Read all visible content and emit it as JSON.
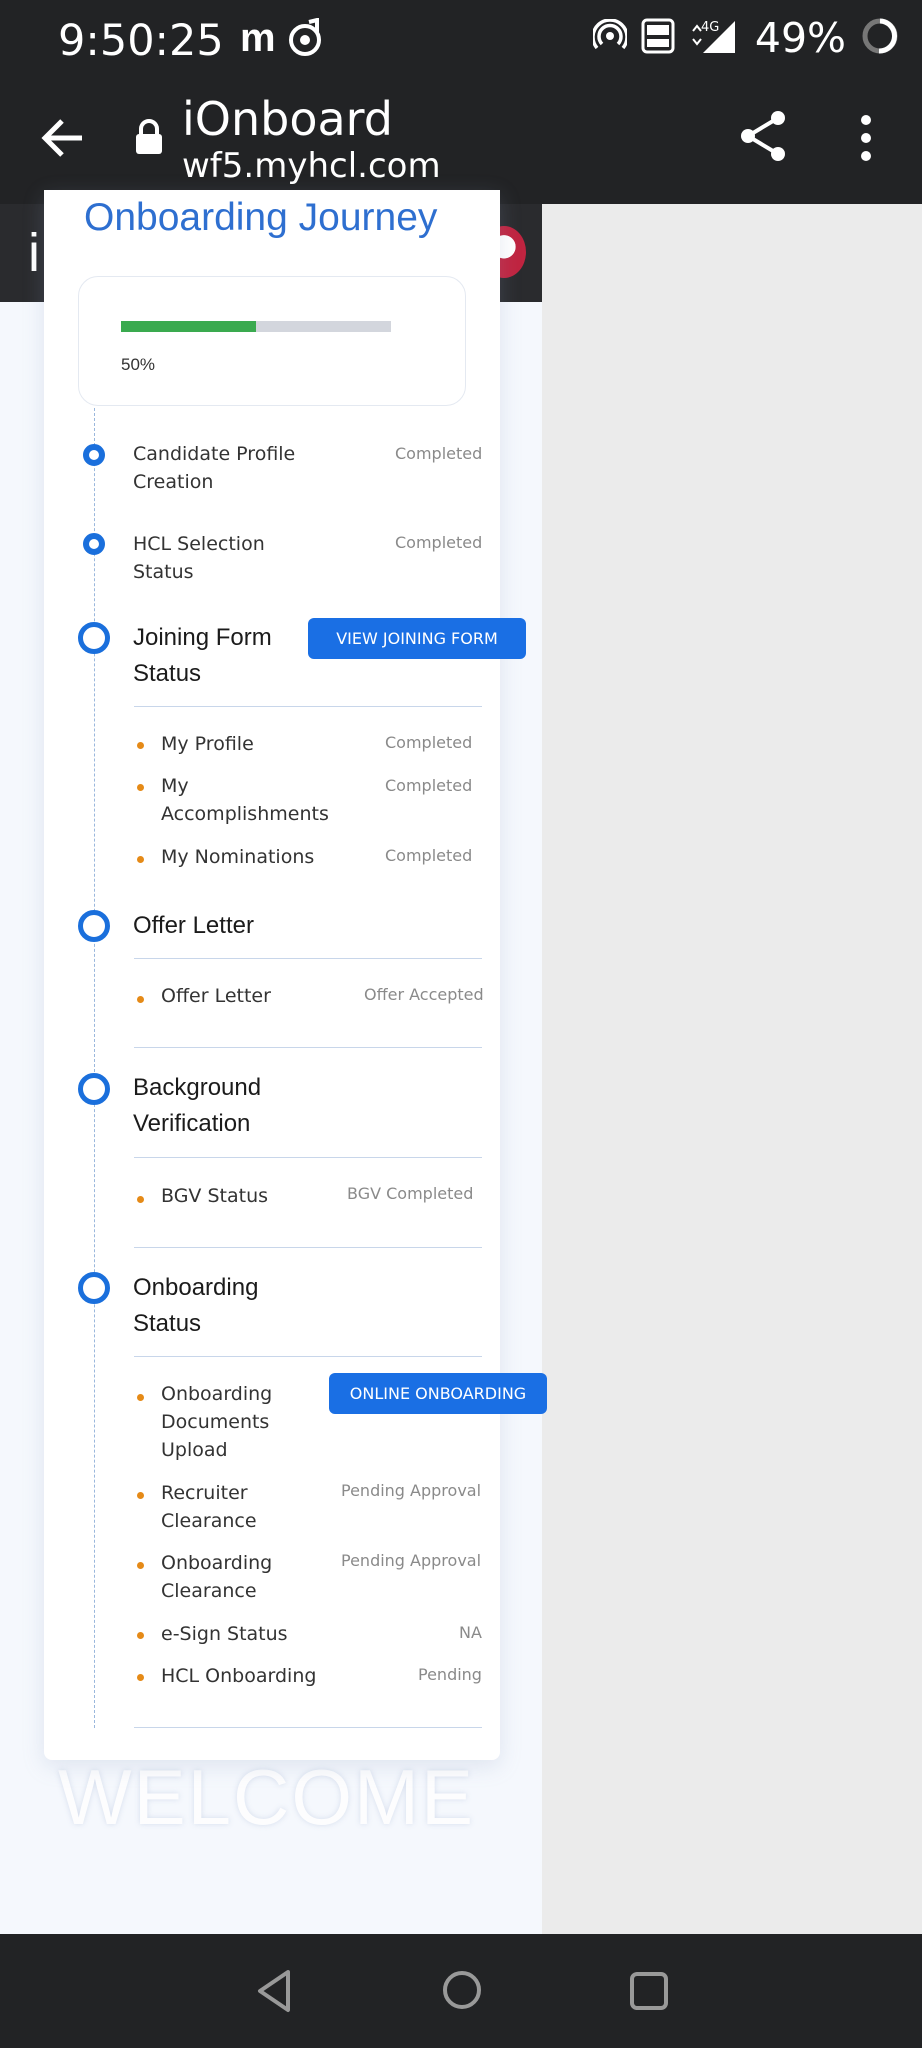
{
  "status_bar": {
    "time": "9:50:25",
    "app_badge": "m",
    "battery": "49%"
  },
  "browser": {
    "title": "iOnboard",
    "host": "wf5.myhcl.com"
  },
  "page": {
    "header_letter": "i",
    "welcome": "WELCOME"
  },
  "journey": {
    "title": "Onboarding Journey",
    "progress_percent": 50,
    "progress_label": "50%",
    "steps": {
      "candidate_profile": {
        "label": "Candidate Profile Creation",
        "status": "Completed"
      },
      "hcl_selection": {
        "label": "HCL Selection Status",
        "status": "Completed"
      },
      "joining_form": {
        "heading": "Joining Form Status",
        "button": "VIEW JOINING FORM",
        "items": [
          {
            "label": "My Profile",
            "status": "Completed"
          },
          {
            "label": "My Accomplishments",
            "status": "Completed"
          },
          {
            "label": "My Nominations",
            "status": "Completed"
          }
        ]
      },
      "offer_letter": {
        "heading": "Offer Letter",
        "items": [
          {
            "label": "Offer Letter",
            "status": "Offer Accepted"
          }
        ]
      },
      "background_verification": {
        "heading": "Background Verification",
        "items": [
          {
            "label": "BGV Status",
            "status": "BGV Completed"
          }
        ]
      },
      "onboarding_status": {
        "heading": "Onboarding Status",
        "button": "ONLINE ONBOARDING",
        "items": [
          {
            "label": "Onboarding Documents Upload",
            "status": ""
          },
          {
            "label": "Recruiter Clearance",
            "status": "Pending Approval"
          },
          {
            "label": "Onboarding Clearance",
            "status": "Pending Approval"
          },
          {
            "label": "e-Sign Status",
            "status": "NA"
          },
          {
            "label": "HCL Onboarding",
            "status": "Pending"
          }
        ]
      }
    }
  },
  "colors": {
    "accent": "#1a6fe4",
    "progress": "#3aaa4f",
    "bullet": "#e58a17",
    "title": "#2e6fd0"
  }
}
